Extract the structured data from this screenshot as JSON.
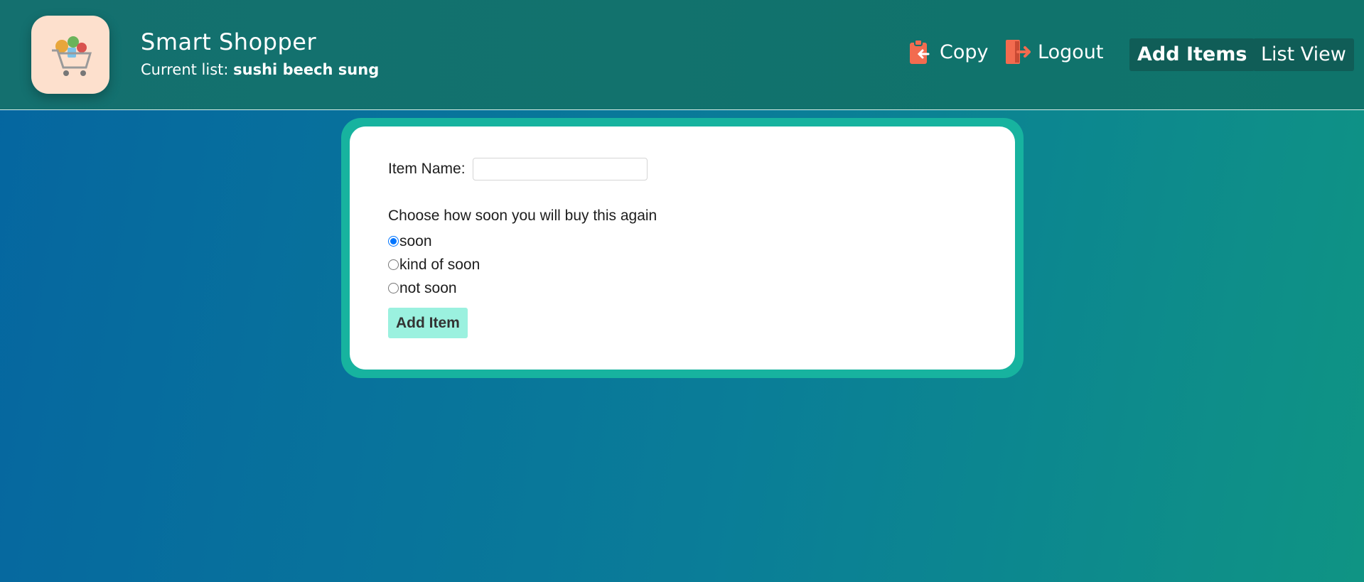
{
  "header": {
    "title": "Smart Shopper",
    "current_list_label": "Current list:",
    "current_list_name": "sushi beech sung",
    "logo_icon": "shopping-cart-logo-icon",
    "actions": {
      "copy_label": "Copy",
      "copy_icon": "clipboard-icon",
      "logout_label": "Logout",
      "logout_icon": "logout-door-icon"
    },
    "nav": {
      "add_items": "Add Items",
      "list_view": "List View"
    }
  },
  "form": {
    "item_name_label": "Item Name:",
    "item_name_value": "",
    "question": "Choose how soon you will buy this again",
    "options": [
      "soon",
      "kind of soon",
      "not soon"
    ],
    "selected_option": "soon",
    "submit_label": "Add Item"
  },
  "colors": {
    "header_bg": "#12706d",
    "accent_icon": "#f26b4f",
    "card_border": "#17b39f",
    "submit_bg": "#9bf1df",
    "nav_btn_bg": "#105d57"
  }
}
